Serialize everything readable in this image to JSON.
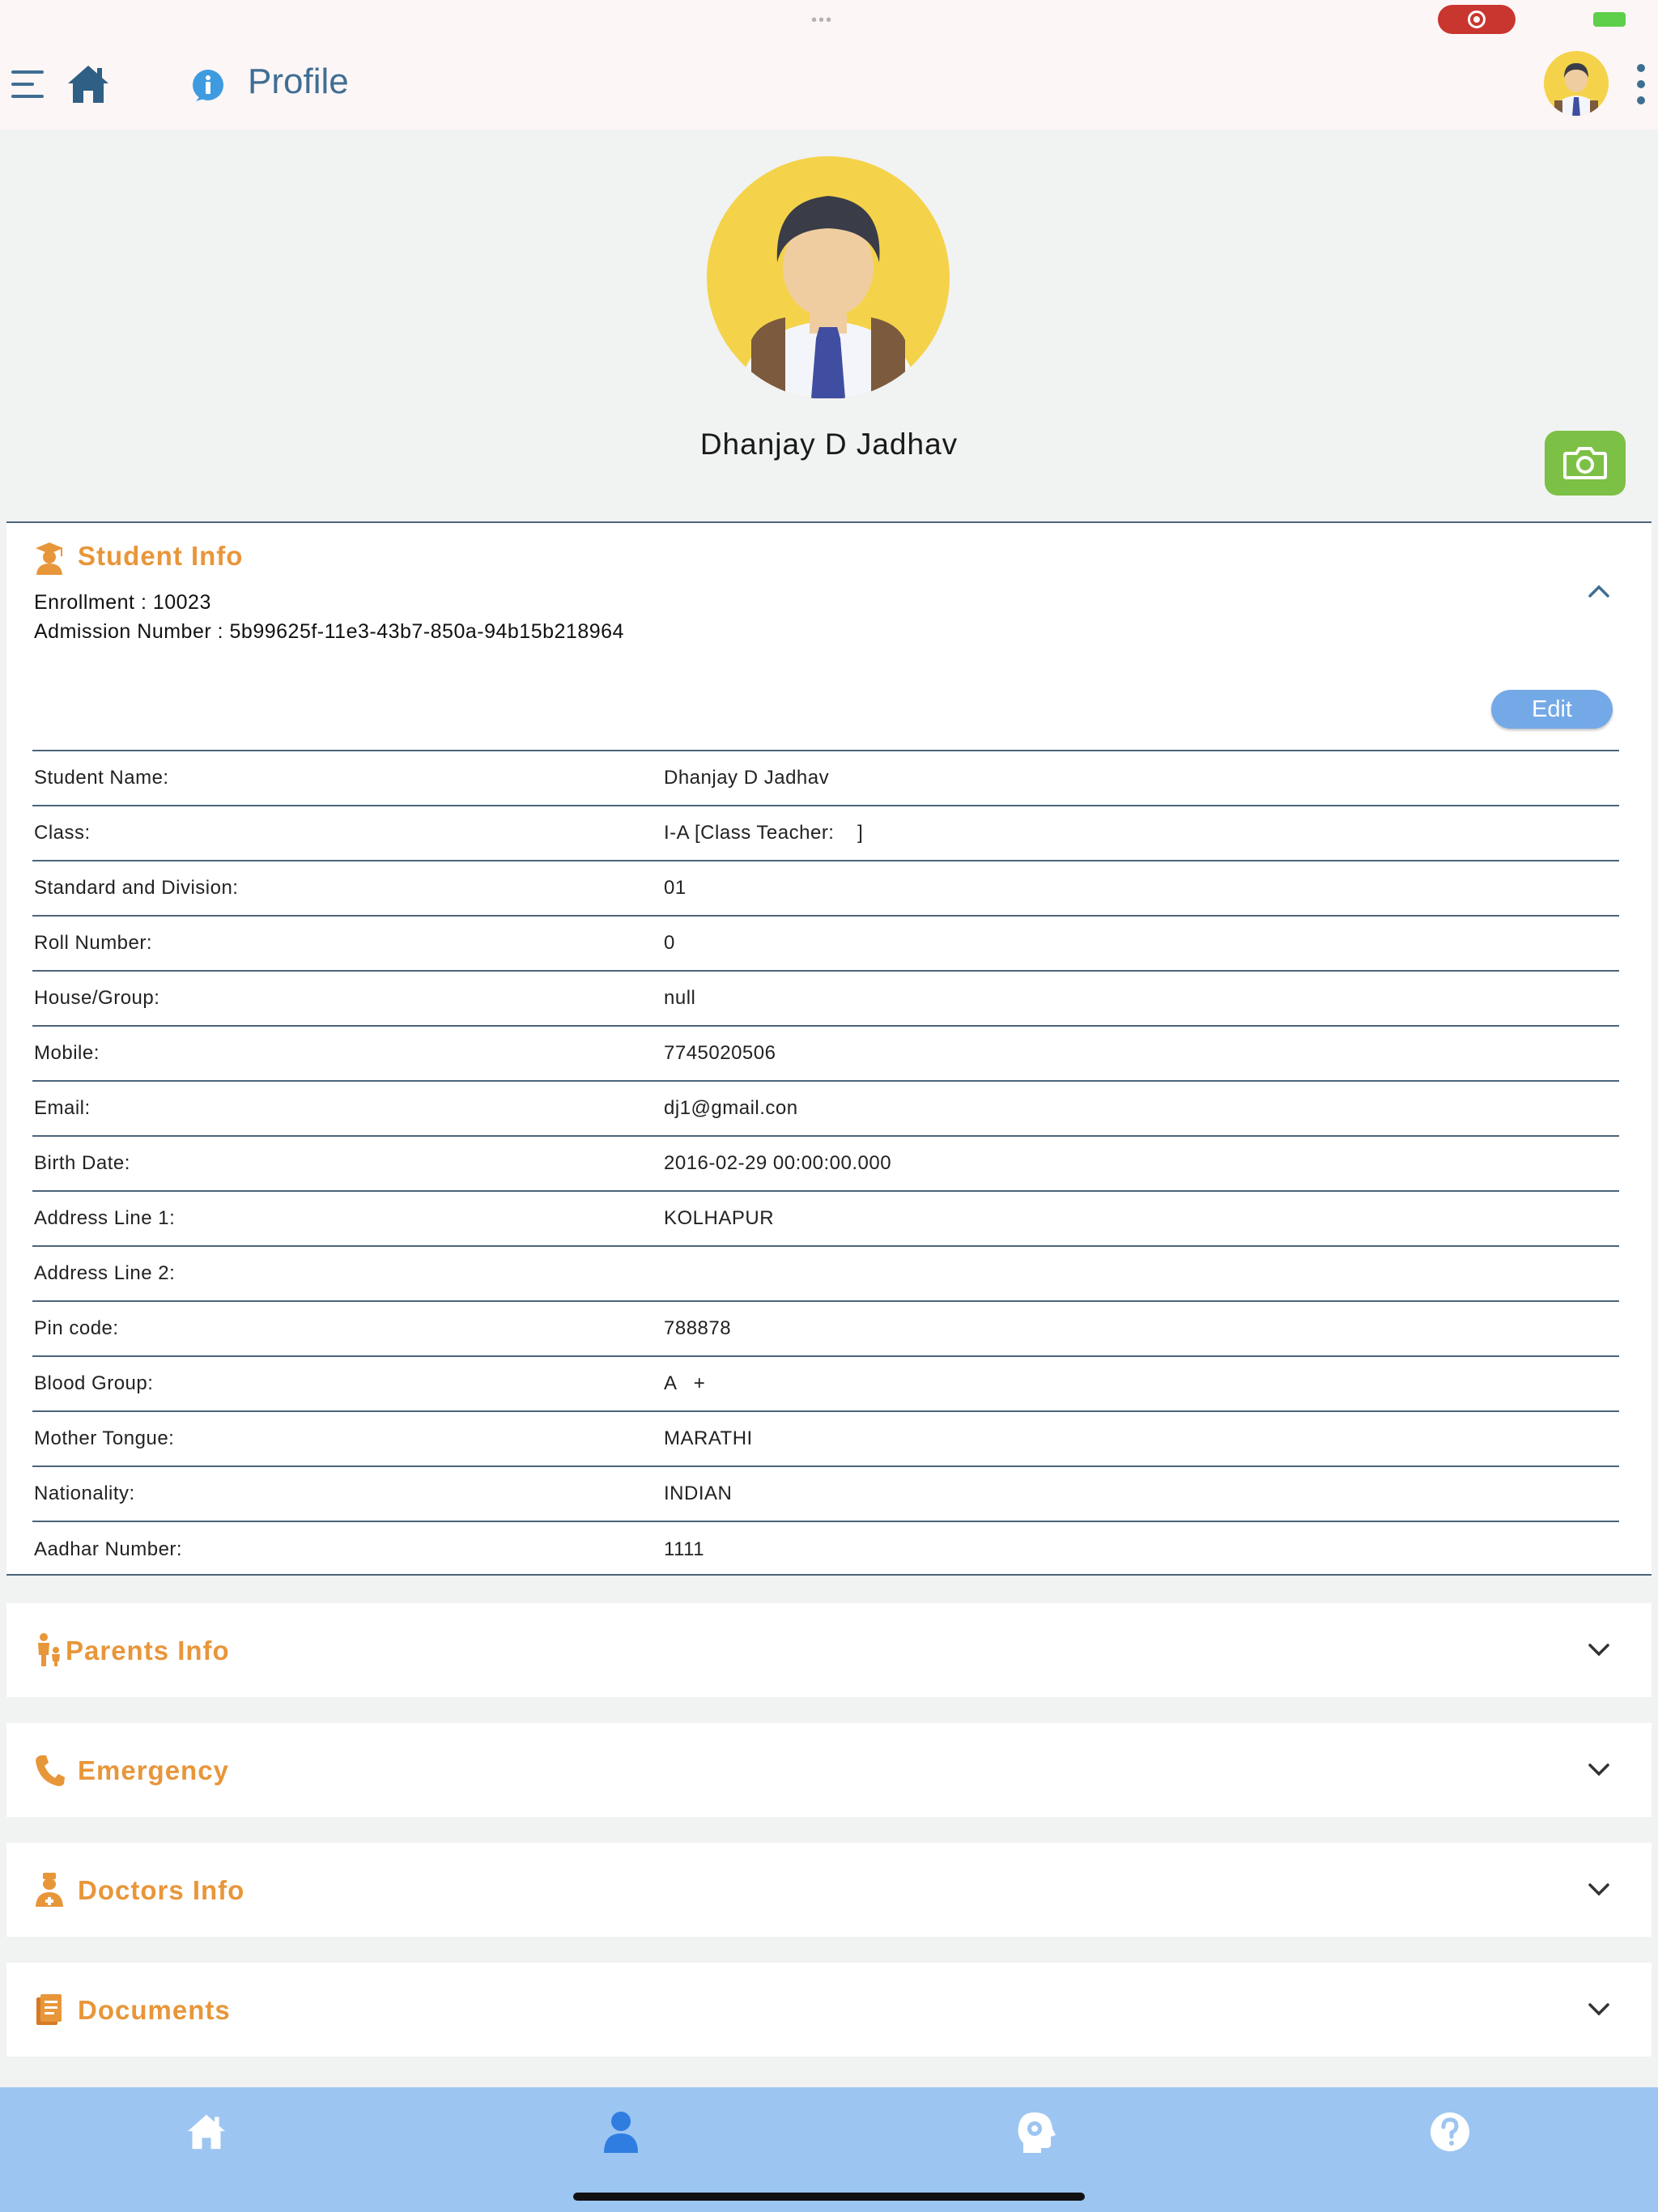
{
  "header": {
    "title": "Profile"
  },
  "profile": {
    "name": "Dhanjay D Jadhav"
  },
  "student_info": {
    "title": "Student Info",
    "enrollment": "Enrollment : 10023",
    "admission": "Admission Number : 5b99625f-11e3-43b7-850a-94b15b218964",
    "edit_label": "Edit",
    "rows": [
      {
        "label": "Student Name:",
        "value": "Dhanjay D Jadhav"
      },
      {
        "label": "Class:",
        "value": "I-A [Class Teacher:    ]"
      },
      {
        "label": "Standard and Division:",
        "value": "01"
      },
      {
        "label": "Roll Number:",
        "value": "0"
      },
      {
        "label": "House/Group:",
        "value": "null"
      },
      {
        "label": "Mobile:",
        "value": "7745020506"
      },
      {
        "label": "Email:",
        "value": "dj1@gmail.con"
      },
      {
        "label": "Birth Date:",
        "value": "2016-02-29 00:00:00.000"
      },
      {
        "label": "Address Line 1:",
        "value": "KOLHAPUR"
      },
      {
        "label": "Address Line 2:",
        "value": ""
      },
      {
        "label": "Pin code:",
        "value": "788878"
      },
      {
        "label": "Blood Group:",
        "value": "A   +"
      },
      {
        "label": "Mother Tongue:",
        "value": "MARATHI"
      },
      {
        "label": "Nationality:",
        "value": "INDIAN"
      },
      {
        "label": "Aadhar Number:",
        "value": "1111"
      }
    ]
  },
  "sections": {
    "parents": "Parents Info",
    "emergency": "Emergency",
    "doctors": "Doctors Info",
    "documents": "Documents"
  },
  "icons": {
    "menu": "hamburger-menu-icon",
    "home": "home-icon",
    "info": "info-icon",
    "camera": "camera-icon",
    "profile": "person-icon",
    "reports": "head-gear-icon",
    "help": "question-icon"
  },
  "colors": {
    "accent_orange": "#e8963a",
    "header_blue": "#3f6e93",
    "camera_green": "#7cc045",
    "edit_blue": "#74a9e7",
    "bottom_nav": "#9cc5f2",
    "record_red": "#c9362f"
  }
}
